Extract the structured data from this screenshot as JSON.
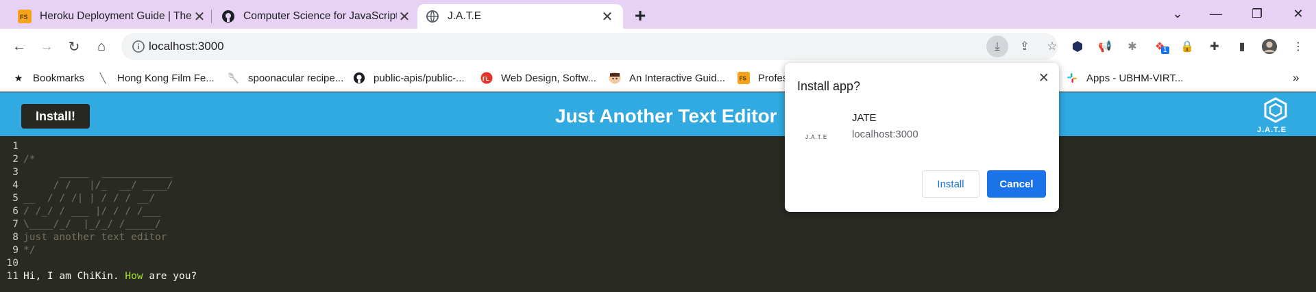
{
  "tabs": [
    {
      "title": "Heroku Deployment Guide | The",
      "favicon": "fs-icon",
      "active": false
    },
    {
      "title": "Computer Science for JavaScript",
      "favicon": "github-icon",
      "active": false
    },
    {
      "title": "J.A.T.E",
      "favicon": "globe-icon",
      "active": true
    }
  ],
  "new_tab_label": "+",
  "toolbar": {
    "url": "localhost:3000"
  },
  "bookmarks": [
    {
      "label": "Bookmarks",
      "icon": "star-icon"
    },
    {
      "label": "Hong Kong Film Fe...",
      "icon": "film-icon"
    },
    {
      "label": "spoonacular recipe...",
      "icon": "spoonacular-icon"
    },
    {
      "label": "public-apis/public-...",
      "icon": "github-icon"
    },
    {
      "label": "Web Design, Softw...",
      "icon": "fl-icon"
    },
    {
      "label": "An Interactive Guid...",
      "icon": "avatar-icon"
    },
    {
      "label": "Profes",
      "icon": "fs-icon"
    },
    {
      "label": "Apps - UBHM-VIRT...",
      "icon": "slack-icon"
    }
  ],
  "extension_badge": "1",
  "app": {
    "install_button": "Install!",
    "title": "Just Another Text Editor",
    "logo_text": "J.A.T.E"
  },
  "editor": {
    "line_numbers": [
      "1",
      "2",
      "3",
      "4",
      "5",
      "6",
      "7",
      "8",
      "9",
      "10",
      "11"
    ],
    "lines": [
      "",
      "/*",
      "      _____  ____________",
      "     / /   |/_  __/ ____/",
      "__  / / /| | / / / __/",
      "/ /_/ / ___ |/ / / /___",
      "\\____/_/  |_/_/ /_____/",
      "just another text editor",
      "*/",
      "",
      ""
    ],
    "line11": {
      "before": "Hi, I am ChiKin. ",
      "keyword": "How",
      "after": " are you?"
    }
  },
  "dialog": {
    "title": "Install app?",
    "app_icon_text": "J.A.T.E",
    "app_name": "JATE",
    "origin": "localhost:3000",
    "install_label": "Install",
    "cancel_label": "Cancel"
  },
  "colors": {
    "tabstrip": "#e7d1f5",
    "header": "#31a9e1",
    "editor_bg": "#292a23",
    "primary": "#1a73e8"
  }
}
